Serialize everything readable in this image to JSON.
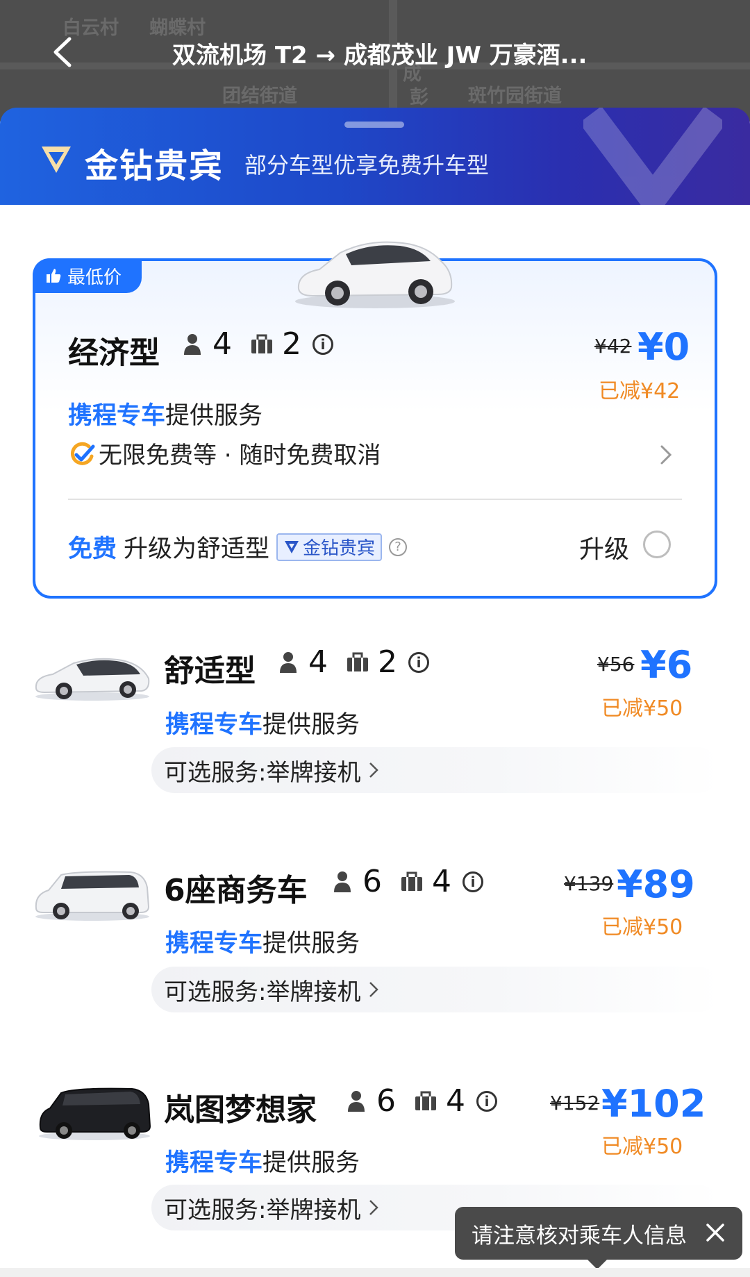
{
  "header": {
    "route_title": "双流机场 T2 → 成都茂业 JW 万豪酒...",
    "map_labels": [
      "白云村",
      "蝴蝶村",
      "团结街道",
      "斑竹园街道",
      "成",
      "彭"
    ]
  },
  "vip_banner": {
    "name": "金钻贵宾",
    "desc": "部分车型优享免费升车型"
  },
  "featured": {
    "tag": "最低价",
    "title": "经济型",
    "passengers": "4",
    "luggage": "2",
    "info": "i",
    "orig_price": "¥42",
    "now_price": "¥0",
    "discount": "已减¥42",
    "provider_brand": "携程专车",
    "provider_rest": "提供服务",
    "features": "无限免费等 · 随时免费取消",
    "upgrade_free": "免费",
    "upgrade_text": "升级为舒适型",
    "upgrade_chip": "金钻贵宾",
    "help": "?",
    "upgrade_label": "升级"
  },
  "cars": [
    {
      "title": "舒适型",
      "passengers": "4",
      "luggage": "2",
      "info": "i",
      "orig_price": "¥56",
      "now_price": "¥6",
      "discount": "已减¥50",
      "provider_brand": "携程专车",
      "provider_rest": "提供服务",
      "service": "可选服务:举牌接机"
    },
    {
      "title": "6座商务车",
      "passengers": "6",
      "luggage": "4",
      "info": "i",
      "orig_price": "¥139",
      "now_price": "¥89",
      "discount": "已减¥50",
      "provider_brand": "携程专车",
      "provider_rest": "提供服务",
      "service": "可选服务:举牌接机"
    },
    {
      "title": "岚图梦想家",
      "passengers": "6",
      "luggage": "4",
      "info": "i",
      "orig_price": "¥152",
      "now_price": "¥102",
      "discount": "已减¥50",
      "provider_brand": "携程专车",
      "provider_rest": "提供服务",
      "service": "可选服务:举牌接机"
    }
  ],
  "toast": {
    "text": "请注意核对乘车人信息"
  },
  "colors": {
    "accent": "#1f73ff",
    "discount": "#f08a24",
    "banner_start": "#1f63e0",
    "banner_end": "#3a2ba0"
  }
}
